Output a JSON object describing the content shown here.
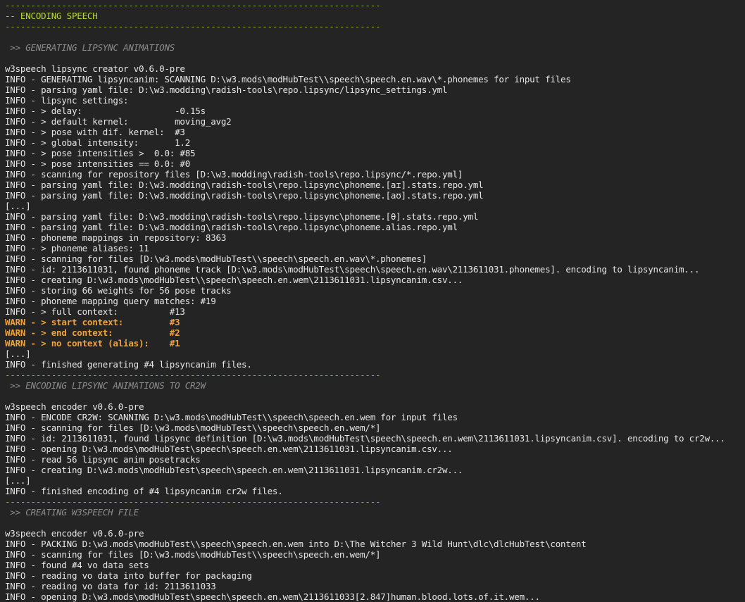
{
  "colors": {
    "background": "#242424",
    "text": "#e6e6e6",
    "separator": "#87b13c",
    "section_title": "#b7d93b",
    "subheader": "#8c8c8c",
    "warn": "#f2a238"
  },
  "lines": [
    {
      "type": "sep",
      "text": "-------------------------------------------------------------------------"
    },
    {
      "type": "section-title",
      "text": "-- ENCODING SPEECH"
    },
    {
      "type": "sep",
      "text": "-------------------------------------------------------------------------"
    },
    {
      "type": "blank",
      "text": ""
    },
    {
      "type": "subheader",
      "text": " >> GENERATING LIPSYNC ANIMATIONS"
    },
    {
      "type": "blank",
      "text": ""
    },
    {
      "type": "plain",
      "text": "w3speech lipsync creator v0.6.0-pre"
    },
    {
      "type": "info",
      "text": "INFO - GENERATING lipsyncanim: SCANNING D:\\w3.mods\\modHubTest\\\\speech\\speech.en.wav\\*.phonemes for input files"
    },
    {
      "type": "info",
      "text": "INFO - parsing yaml file: D:\\w3.modding\\radish-tools\\repo.lipsync/lipsync_settings.yml"
    },
    {
      "type": "info",
      "text": "INFO - lipsync settings:"
    },
    {
      "type": "info",
      "text": "INFO - > delay:                  -0.15s"
    },
    {
      "type": "info",
      "text": "INFO - > default kernel:         moving_avg2"
    },
    {
      "type": "info",
      "text": "INFO - > pose with dif. kernel:  #3"
    },
    {
      "type": "info",
      "text": "INFO - > global intensity:       1.2"
    },
    {
      "type": "info",
      "text": "INFO - > pose intensities >  0.0: #85"
    },
    {
      "type": "info",
      "text": "INFO - > pose intensities == 0.0: #0"
    },
    {
      "type": "info",
      "text": "INFO - scanning for repository files [D:\\w3.modding\\radish-tools\\repo.lipsync/*.repo.yml]"
    },
    {
      "type": "info",
      "text": "INFO - parsing yaml file: D:\\w3.modding\\radish-tools\\repo.lipsync\\phoneme.[aɪ].stats.repo.yml"
    },
    {
      "type": "info",
      "text": "INFO - parsing yaml file: D:\\w3.modding\\radish-tools\\repo.lipsync\\phoneme.[aʊ].stats.repo.yml"
    },
    {
      "type": "plain",
      "text": "[...]"
    },
    {
      "type": "info",
      "text": "INFO - parsing yaml file: D:\\w3.modding\\radish-tools\\repo.lipsync\\phoneme.[θ].stats.repo.yml"
    },
    {
      "type": "info",
      "text": "INFO - parsing yaml file: D:\\w3.modding\\radish-tools\\repo.lipsync\\phoneme.alias.repo.yml"
    },
    {
      "type": "info",
      "text": "INFO - phoneme mappings in repository: 8363"
    },
    {
      "type": "info",
      "text": "INFO - > phoneme aliases: 11"
    },
    {
      "type": "info",
      "text": "INFO - scanning for files [D:\\w3.mods\\modHubTest\\\\speech\\speech.en.wav\\*.phonemes]"
    },
    {
      "type": "info",
      "text": "INFO - id: 2113611031, found phoneme track [D:\\w3.mods\\modHubTest\\speech\\speech.en.wav\\2113611031.phonemes]. encoding to lipsyncanim..."
    },
    {
      "type": "info",
      "text": "INFO - creating D:\\w3.mods\\modHubTest\\\\speech\\speech.en.wem\\2113611031.lipsyncanim.csv..."
    },
    {
      "type": "info",
      "text": "INFO - storing 66 weights for 56 pose tracks"
    },
    {
      "type": "info",
      "text": "INFO - phoneme mapping query matches: #19"
    },
    {
      "type": "info",
      "text": "INFO - > full context:          #13"
    },
    {
      "type": "warn",
      "text": "WARN - > start context:         #3"
    },
    {
      "type": "warn",
      "text": "WARN - > end context:           #2"
    },
    {
      "type": "warn",
      "text": "WARN - > no context (alias):    #1"
    },
    {
      "type": "plain",
      "text": "[...]"
    },
    {
      "type": "info",
      "text": "INFO - finished generating #4 lipsyncanim files."
    },
    {
      "type": "sep",
      "text": "-------------------------------------------------------------------------"
    },
    {
      "type": "subheader",
      "text": " >> ENCODING LIPSYNC ANIMATIONS TO CR2W"
    },
    {
      "type": "blank",
      "text": ""
    },
    {
      "type": "plain",
      "text": "w3speech encoder v0.6.0-pre"
    },
    {
      "type": "info",
      "text": "INFO - ENCODE CR2W: SCANNING D:\\w3.mods\\modHubTest\\\\speech\\speech.en.wem for input files"
    },
    {
      "type": "info",
      "text": "INFO - scanning for files [D:\\w3.mods\\modHubTest\\\\speech\\speech.en.wem/*]"
    },
    {
      "type": "info",
      "text": "INFO - id: 2113611031, found lipsync definition [D:\\w3.mods\\modHubTest\\speech\\speech.en.wem\\2113611031.lipsyncanim.csv]. encoding to cr2w..."
    },
    {
      "type": "info",
      "text": "INFO - opening D:\\w3.mods\\modHubTest\\speech\\speech.en.wem\\2113611031.lipsyncanim.csv..."
    },
    {
      "type": "info",
      "text": "INFO - read 56 lipsync anim posetracks"
    },
    {
      "type": "info",
      "text": "INFO - creating D:\\w3.mods\\modHubTest\\speech\\speech.en.wem\\2113611031.lipsyncanim.cr2w..."
    },
    {
      "type": "plain",
      "text": "[...]"
    },
    {
      "type": "info",
      "text": "INFO - finished encoding of #4 lipsyncanim cr2w files."
    },
    {
      "type": "sep",
      "text": "-------------------------------------------------------------------------"
    },
    {
      "type": "subheader",
      "text": " >> CREATING W3SPEECH FILE"
    },
    {
      "type": "blank",
      "text": ""
    },
    {
      "type": "plain",
      "text": "w3speech encoder v0.6.0-pre"
    },
    {
      "type": "info",
      "text": "INFO - PACKING D:\\w3.mods\\modHubTest\\\\speech\\speech.en.wem into D:\\The Witcher 3 Wild Hunt\\dlc\\dlcHubTest\\content"
    },
    {
      "type": "info",
      "text": "INFO - scanning for files [D:\\w3.mods\\modHubTest\\\\speech\\speech.en.wem/*]"
    },
    {
      "type": "info",
      "text": "INFO - found #4 vo data sets"
    },
    {
      "type": "info",
      "text": "INFO - reading vo data into buffer for packaging"
    },
    {
      "type": "info",
      "text": "INFO - reading vo data for id: 2113611033"
    },
    {
      "type": "info",
      "text": "INFO - opening D:\\w3.mods\\modHubTest\\speech\\speech.en.wem\\2113611033[2.847]human.blood.lots.of.it.wem..."
    }
  ]
}
